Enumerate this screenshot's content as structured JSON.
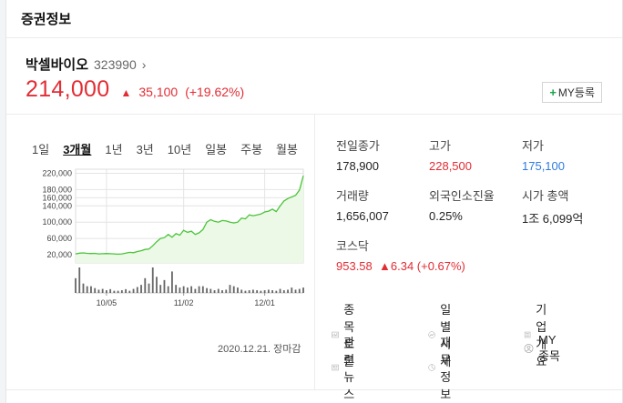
{
  "header": {
    "title": "증권정보"
  },
  "stock": {
    "name": "박셀바이오",
    "code": "323990",
    "price": "214,000",
    "change": "35,100",
    "change_pct": "(+19.62%)",
    "my_button": "MY등록"
  },
  "periods": [
    {
      "label": "1일",
      "active": false
    },
    {
      "label": "3개월",
      "active": true
    },
    {
      "label": "1년",
      "active": false
    },
    {
      "label": "3년",
      "active": false
    },
    {
      "label": "10년",
      "active": false
    },
    {
      "label": "일봉",
      "active": false
    },
    {
      "label": "주봉",
      "active": false
    },
    {
      "label": "월봉",
      "active": false
    }
  ],
  "chart_data": {
    "type": "area",
    "y_ticks": [
      "220,000",
      "180,000",
      "160,000",
      "140,000",
      "100,000",
      "60,000",
      "20,000"
    ],
    "x_ticks": [
      "10/05",
      "11/02",
      "12/01"
    ],
    "ylim": [
      0,
      230000
    ],
    "values": [
      22000,
      24000,
      24500,
      23500,
      23000,
      23500,
      22000,
      22500,
      23000,
      22500,
      22000,
      21500,
      22000,
      24000,
      26000,
      25000,
      28000,
      30000,
      33000,
      34000,
      42000,
      52000,
      60000,
      62000,
      70000,
      63000,
      72000,
      68000,
      80000,
      75000,
      78000,
      70000,
      74000,
      82000,
      100000,
      106000,
      102000,
      100000,
      104000,
      103000,
      100000,
      98000,
      100000,
      110000,
      108000,
      118000,
      116000,
      118000,
      120000,
      125000,
      127000,
      132000,
      126000,
      140000,
      152000,
      158000,
      162000,
      166000,
      178900,
      214000
    ],
    "volumes": [
      55,
      95,
      35,
      25,
      25,
      18,
      12,
      15,
      10,
      14,
      8,
      8,
      10,
      14,
      8,
      15,
      22,
      30,
      55,
      35,
      95,
      60,
      30,
      48,
      25,
      80,
      30,
      20,
      25,
      20,
      25,
      15,
      25,
      25,
      18,
      15,
      10,
      15,
      10,
      12,
      30,
      25,
      20,
      12,
      8,
      10,
      12,
      10,
      8,
      10,
      12,
      10,
      8,
      15,
      10,
      12,
      20,
      12,
      15,
      20
    ],
    "colors": {
      "line": "#4cc43b",
      "fill": "#ebf9e6",
      "grid": "#e4e4e4",
      "volume": "#666666"
    }
  },
  "chart_note": "2020.12.21. 장마감",
  "stats": {
    "prev_close": {
      "label": "전일종가",
      "value": "178,900"
    },
    "high": {
      "label": "고가",
      "value": "228,500"
    },
    "low": {
      "label": "저가",
      "value": "175,100"
    },
    "volume": {
      "label": "거래량",
      "value": "1,656,007"
    },
    "foreign": {
      "label": "외국인소진율",
      "value": "0.25%"
    },
    "market_cap": {
      "label": "시가 총액",
      "value": "1조 6,099억"
    },
    "index": {
      "label": "코스닥",
      "value": "953.58",
      "change": "▲6.34 (+0.67%)"
    }
  },
  "links": {
    "discussion": "종목토론",
    "daily": "일별시세",
    "company": "기업개요",
    "news": "관련뉴스",
    "finance": "재무정보",
    "my": "MY종목"
  },
  "colors": {
    "up": "#e22d34",
    "down": "#2f7be0"
  }
}
